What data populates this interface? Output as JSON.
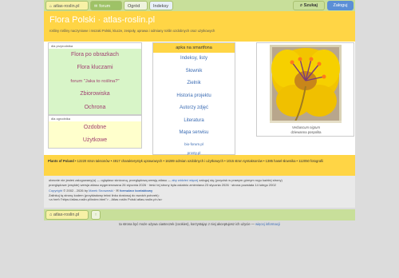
{
  "topbar": {
    "home_tab": "atlas-roslin.pl",
    "forum_tab": "forum",
    "garden_tab": "Ogród",
    "indexes_tab": "Indeksy",
    "search_button": "Szukaj",
    "login_button": "Zaloguj"
  },
  "header": {
    "title": "Flora Polski · atlas-roslin.pl",
    "subtitle": "rośliny rośliny naczyniowe i mszaki Polski, klucze, zespoły, uprawa i odmiany roślin ozdobnych oraz użytkowych"
  },
  "left": {
    "nature_label": "dla przyrodnika",
    "nature_items": [
      "Flora po obrazkach",
      "Flora kluczami",
      "forum \"Jaka to roślina?\"",
      "Zbiorowiska",
      "Ochrona"
    ],
    "garden_label": "dla ogrodnika",
    "garden_items": [
      "Ozdobne",
      "Użytkowe"
    ]
  },
  "middle": {
    "app_link": "apka na smartfona",
    "links": [
      "Indeksy, listy",
      "Słownik",
      "Zielnik",
      "Historia projektu",
      "Autorzy zdjęć",
      "Literatura",
      "Mapa serwisu"
    ],
    "small_links": [
      "bio-forum.pl",
      "prosty.pl"
    ]
  },
  "photo": {
    "latin_name": "Verbascum nigrum",
    "polish_name": "dziewanna pospolita"
  },
  "stats": {
    "brand": "Plants of Poland",
    "text": "• 12220 stron taksonów • 4917 charakterystyk uprawowych • 16289 odmian ozdobnych i użytkowych • 1015 stron syntaksonów • 1385 haseł słownika • 112050 fotografii"
  },
  "footer": {
    "line1_a": "obecnie nie jesteś zalogowany(a) — oglądasz skróconą, przeglądową wersję atlasu —",
    "line1_link": "aby widzieć więcej",
    "line1_b": "zaloguj się (przycisk w prawym górnym rogu każdej strony)",
    "line2": "przeglądowe (zwykłe) wersja atlasu wygenerowana 26 stycznia 2026 · treść tej strony była ostatnio zmieniana 23 stycznia 2026 · strona powstała 14 lutego 2002",
    "copyright_link": "Copyright",
    "copyright_text": "© 2002 - 2026 by",
    "author_link": "Marek Snowarski",
    "contact_link": "formularz kontaktowy",
    "code_line1": "Zalinkuj tą stronę kodem (przykładowy tekst linku dostosuj do swoich potrzeb):",
    "code_line2": "<a href=\"https://atlas-roslin.pl/index.html\"> - Atlas roślin Polski atlas-roslin.pl</a>"
  },
  "bottombar": {
    "home_tab": "atlas-roslin.pl",
    "up_icon": "↑"
  },
  "cookie": {
    "text": "ta strona być może używa ciasteczek (cookies), korzystając z niej akceptujesz ich użycie —",
    "link": "więcej informacji"
  },
  "colors": {
    "header_yellow": "#ffd545",
    "nav_green": "#c8df9a",
    "link_blue": "#3a6bb3",
    "menu_pink": "#a04070"
  }
}
